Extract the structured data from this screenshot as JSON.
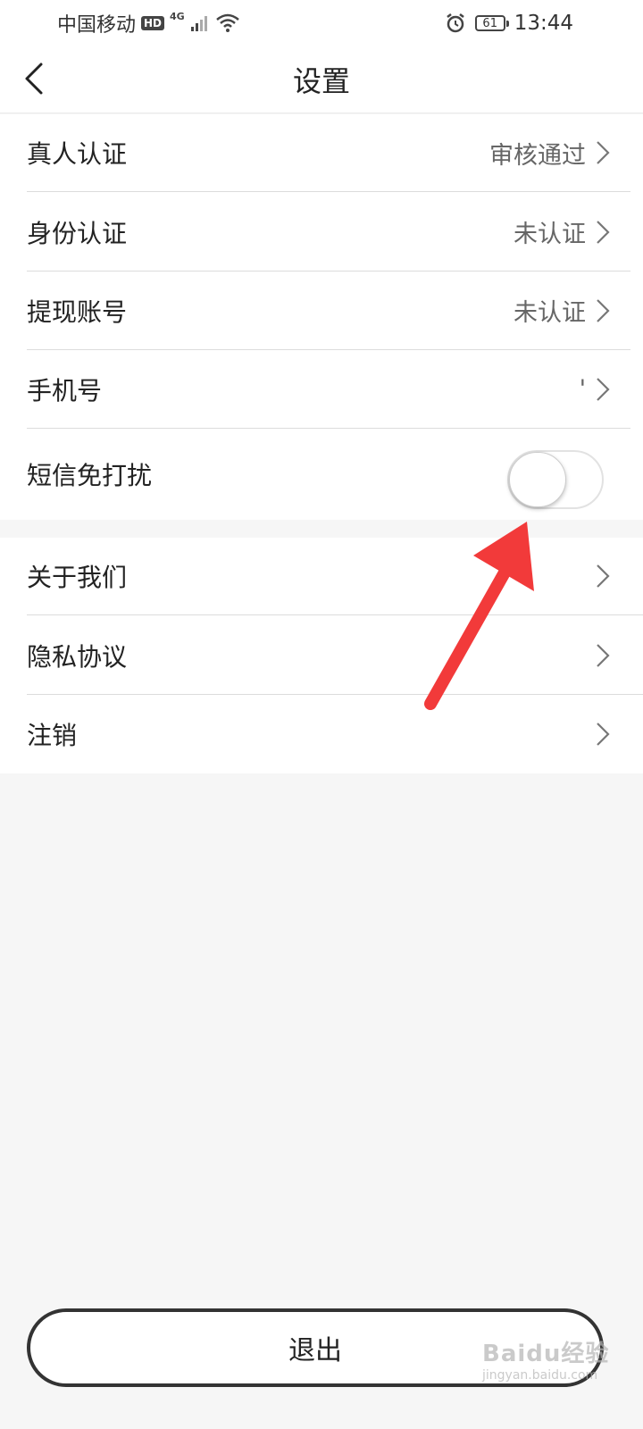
{
  "status_bar": {
    "carrier": "中国移动",
    "hd": "HD",
    "network": "4G",
    "battery": "61",
    "time": "13:44"
  },
  "nav": {
    "title": "设置"
  },
  "group1": [
    {
      "label": "真人认证",
      "value": "审核通过"
    },
    {
      "label": "身份认证",
      "value": "未认证"
    },
    {
      "label": "提现账号",
      "value": "未认证"
    },
    {
      "label": "手机号",
      "value": "'"
    }
  ],
  "sms_toggle": {
    "label": "短信免打扰",
    "on": false
  },
  "group2": [
    {
      "label": "关于我们"
    },
    {
      "label": "隐私协议"
    },
    {
      "label": "注销"
    }
  ],
  "logout": {
    "label": "退出"
  },
  "watermark": {
    "text": "Baidu经验",
    "sub": "jingyan.baidu.com"
  },
  "colors": {
    "annotation_arrow": "#f23a3a",
    "background": "#f6f6f6"
  }
}
